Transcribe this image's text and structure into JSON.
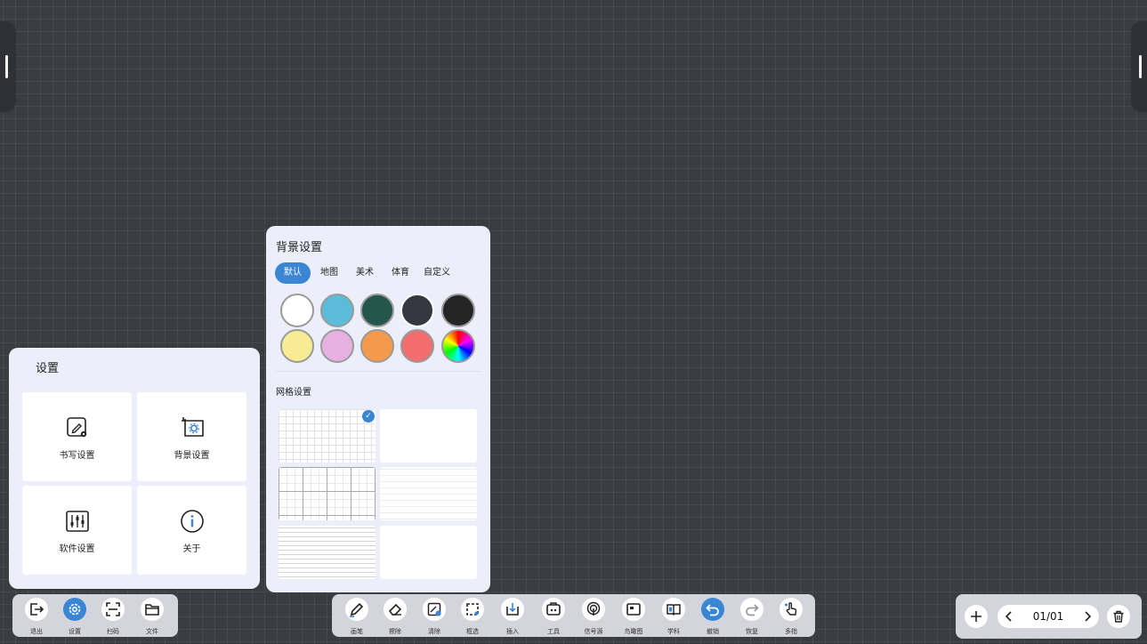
{
  "settings": {
    "title": "设置",
    "cards": [
      {
        "label": "书写设置",
        "icon": "pen-settings-icon"
      },
      {
        "label": "背景设置",
        "icon": "background-settings-icon"
      },
      {
        "label": "软件设置",
        "icon": "sliders-icon"
      },
      {
        "label": "关于",
        "icon": "info-icon"
      }
    ]
  },
  "background": {
    "title": "背景设置",
    "tabs": [
      {
        "label": "默认",
        "active": true
      },
      {
        "label": "地图",
        "active": false
      },
      {
        "label": "美术",
        "active": false
      },
      {
        "label": "体育",
        "active": false
      },
      {
        "label": "自定义",
        "active": false
      }
    ],
    "colors": [
      "#ffffff",
      "#5bbcd9",
      "#25564d",
      "#353840",
      "#252525",
      "#f7ec94",
      "#e6b1e0",
      "#f59a4d",
      "#f26d6d",
      "rainbow"
    ],
    "grid_title": "网格设置",
    "grids": [
      {
        "icon": "grid-square-fine",
        "selected": true
      },
      {
        "icon": "grid-blank",
        "selected": false
      },
      {
        "icon": "grid-square-bold",
        "selected": false
      },
      {
        "icon": "grid-lines-light",
        "selected": false
      },
      {
        "icon": "grid-lines-dense",
        "selected": false
      },
      {
        "icon": "grid-blank",
        "selected": false
      }
    ]
  },
  "left_toolbar": {
    "items": [
      {
        "label": "退出",
        "icon": "exit-icon",
        "active": false
      },
      {
        "label": "设置",
        "icon": "gear-icon",
        "active": true
      },
      {
        "label": "扫码",
        "icon": "scan-icon",
        "active": false
      },
      {
        "label": "文件",
        "icon": "folder-icon",
        "active": false
      }
    ]
  },
  "main_toolbar": {
    "items": [
      {
        "label": "画笔",
        "icon": "pen-icon",
        "active": false
      },
      {
        "label": "擦除",
        "icon": "eraser-icon",
        "active": false
      },
      {
        "label": "清除",
        "icon": "clear-icon",
        "active": false
      },
      {
        "label": "框选",
        "icon": "select-icon",
        "active": false
      },
      {
        "label": "插入",
        "icon": "insert-icon",
        "active": false
      },
      {
        "label": "工具",
        "icon": "toolbox-icon",
        "active": false
      },
      {
        "label": "信号源",
        "icon": "signal-icon",
        "active": false
      },
      {
        "label": "鸟瞰图",
        "icon": "overview-icon",
        "active": false
      },
      {
        "label": "学科",
        "icon": "book-icon",
        "active": false
      },
      {
        "label": "撤销",
        "icon": "undo-icon",
        "active": true
      },
      {
        "label": "恢复",
        "icon": "redo-icon",
        "active": false
      },
      {
        "label": "多指",
        "icon": "touch-icon",
        "active": false
      }
    ]
  },
  "page_nav": {
    "counter": "01/01"
  }
}
